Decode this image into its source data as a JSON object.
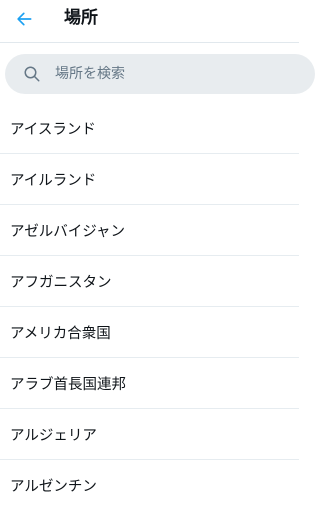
{
  "header": {
    "title": "場所",
    "back_icon": "arrow-left-icon",
    "accent_color": "#1da1f2"
  },
  "search": {
    "placeholder": "場所を検索",
    "value": "",
    "icon": "search-icon"
  },
  "locations": [
    {
      "label": "アイスランド"
    },
    {
      "label": "アイルランド"
    },
    {
      "label": "アゼルバイジャン"
    },
    {
      "label": "アフガニスタン"
    },
    {
      "label": "アメリカ合衆国"
    },
    {
      "label": "アラブ首長国連邦"
    },
    {
      "label": "アルジェリア"
    },
    {
      "label": "アルゼンチン"
    }
  ]
}
